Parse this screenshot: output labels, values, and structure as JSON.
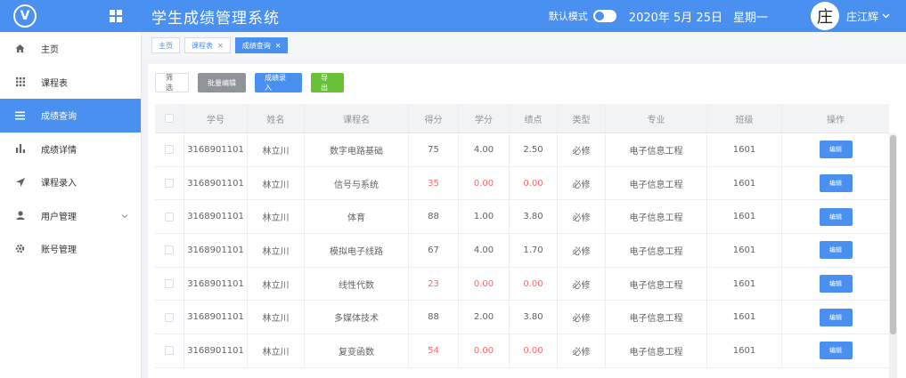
{
  "header": {
    "title": "学生成绩管理系统",
    "mode_label": "默认模式",
    "date": "2020年 5月 25日",
    "weekday": "星期一",
    "avatar_char": "庄",
    "user_name": "庄江辉",
    "bg_color": "#4a90f0"
  },
  "sidebar": {
    "items": [
      {
        "label": "主页",
        "icon": "home-icon"
      },
      {
        "label": "课程表",
        "icon": "grid-icon"
      },
      {
        "label": "成绩查询",
        "icon": "list-icon",
        "active": true
      },
      {
        "label": "成绩详情",
        "icon": "bar-chart-icon"
      },
      {
        "label": "课程录入",
        "icon": "send-icon"
      },
      {
        "label": "用户管理",
        "icon": "user-icon",
        "has_submenu": true
      },
      {
        "label": "账号管理",
        "icon": "gear-icon"
      }
    ]
  },
  "tabs": [
    {
      "label": "主页",
      "closable": false
    },
    {
      "label": "课程表",
      "closable": true
    },
    {
      "label": "成绩查询",
      "closable": true,
      "active": true
    }
  ],
  "toolbar": {
    "filter_label": "筛选",
    "batch_edit_label": "批量编辑",
    "entry_label": "成绩录入",
    "export_label": "导出"
  },
  "table": {
    "headers": [
      "学号",
      "姓名",
      "课程名",
      "得分",
      "学分",
      "绩点",
      "类型",
      "专业",
      "班级",
      "操作"
    ],
    "edit_label": "编辑",
    "rows": [
      {
        "sid": "3168901101",
        "name": "林立川",
        "course": "数字电路基础",
        "score": "75",
        "credit": "4.00",
        "gpa": "2.50",
        "type": "必修",
        "major": "电子信息工程",
        "class": "1601",
        "fail": false
      },
      {
        "sid": "3168901101",
        "name": "林立川",
        "course": "信号与系统",
        "score": "35",
        "credit": "0.00",
        "gpa": "0.00",
        "type": "必修",
        "major": "电子信息工程",
        "class": "1601",
        "fail": true
      },
      {
        "sid": "3168901101",
        "name": "林立川",
        "course": "体育",
        "score": "88",
        "credit": "1.00",
        "gpa": "3.80",
        "type": "必修",
        "major": "电子信息工程",
        "class": "1601",
        "fail": false
      },
      {
        "sid": "3168901101",
        "name": "林立川",
        "course": "模拟电子线路",
        "score": "67",
        "credit": "4.00",
        "gpa": "1.70",
        "type": "必修",
        "major": "电子信息工程",
        "class": "1601",
        "fail": false
      },
      {
        "sid": "3168901101",
        "name": "林立川",
        "course": "线性代数",
        "score": "23",
        "credit": "0.00",
        "gpa": "0.00",
        "type": "必修",
        "major": "电子信息工程",
        "class": "1601",
        "fail": true
      },
      {
        "sid": "3168901101",
        "name": "林立川",
        "course": "多媒体技术",
        "score": "88",
        "credit": "2.00",
        "gpa": "3.80",
        "type": "必修",
        "major": "电子信息工程",
        "class": "1601",
        "fail": false
      },
      {
        "sid": "3168901101",
        "name": "林立川",
        "course": "复变函数",
        "score": "54",
        "credit": "0.00",
        "gpa": "0.00",
        "type": "必修",
        "major": "电子信息工程",
        "class": "1601",
        "fail": true
      }
    ]
  },
  "colors": {
    "primary": "#4a90f0",
    "fail": "#f56c6c",
    "export": "#67c23a",
    "batch": "#909399"
  }
}
